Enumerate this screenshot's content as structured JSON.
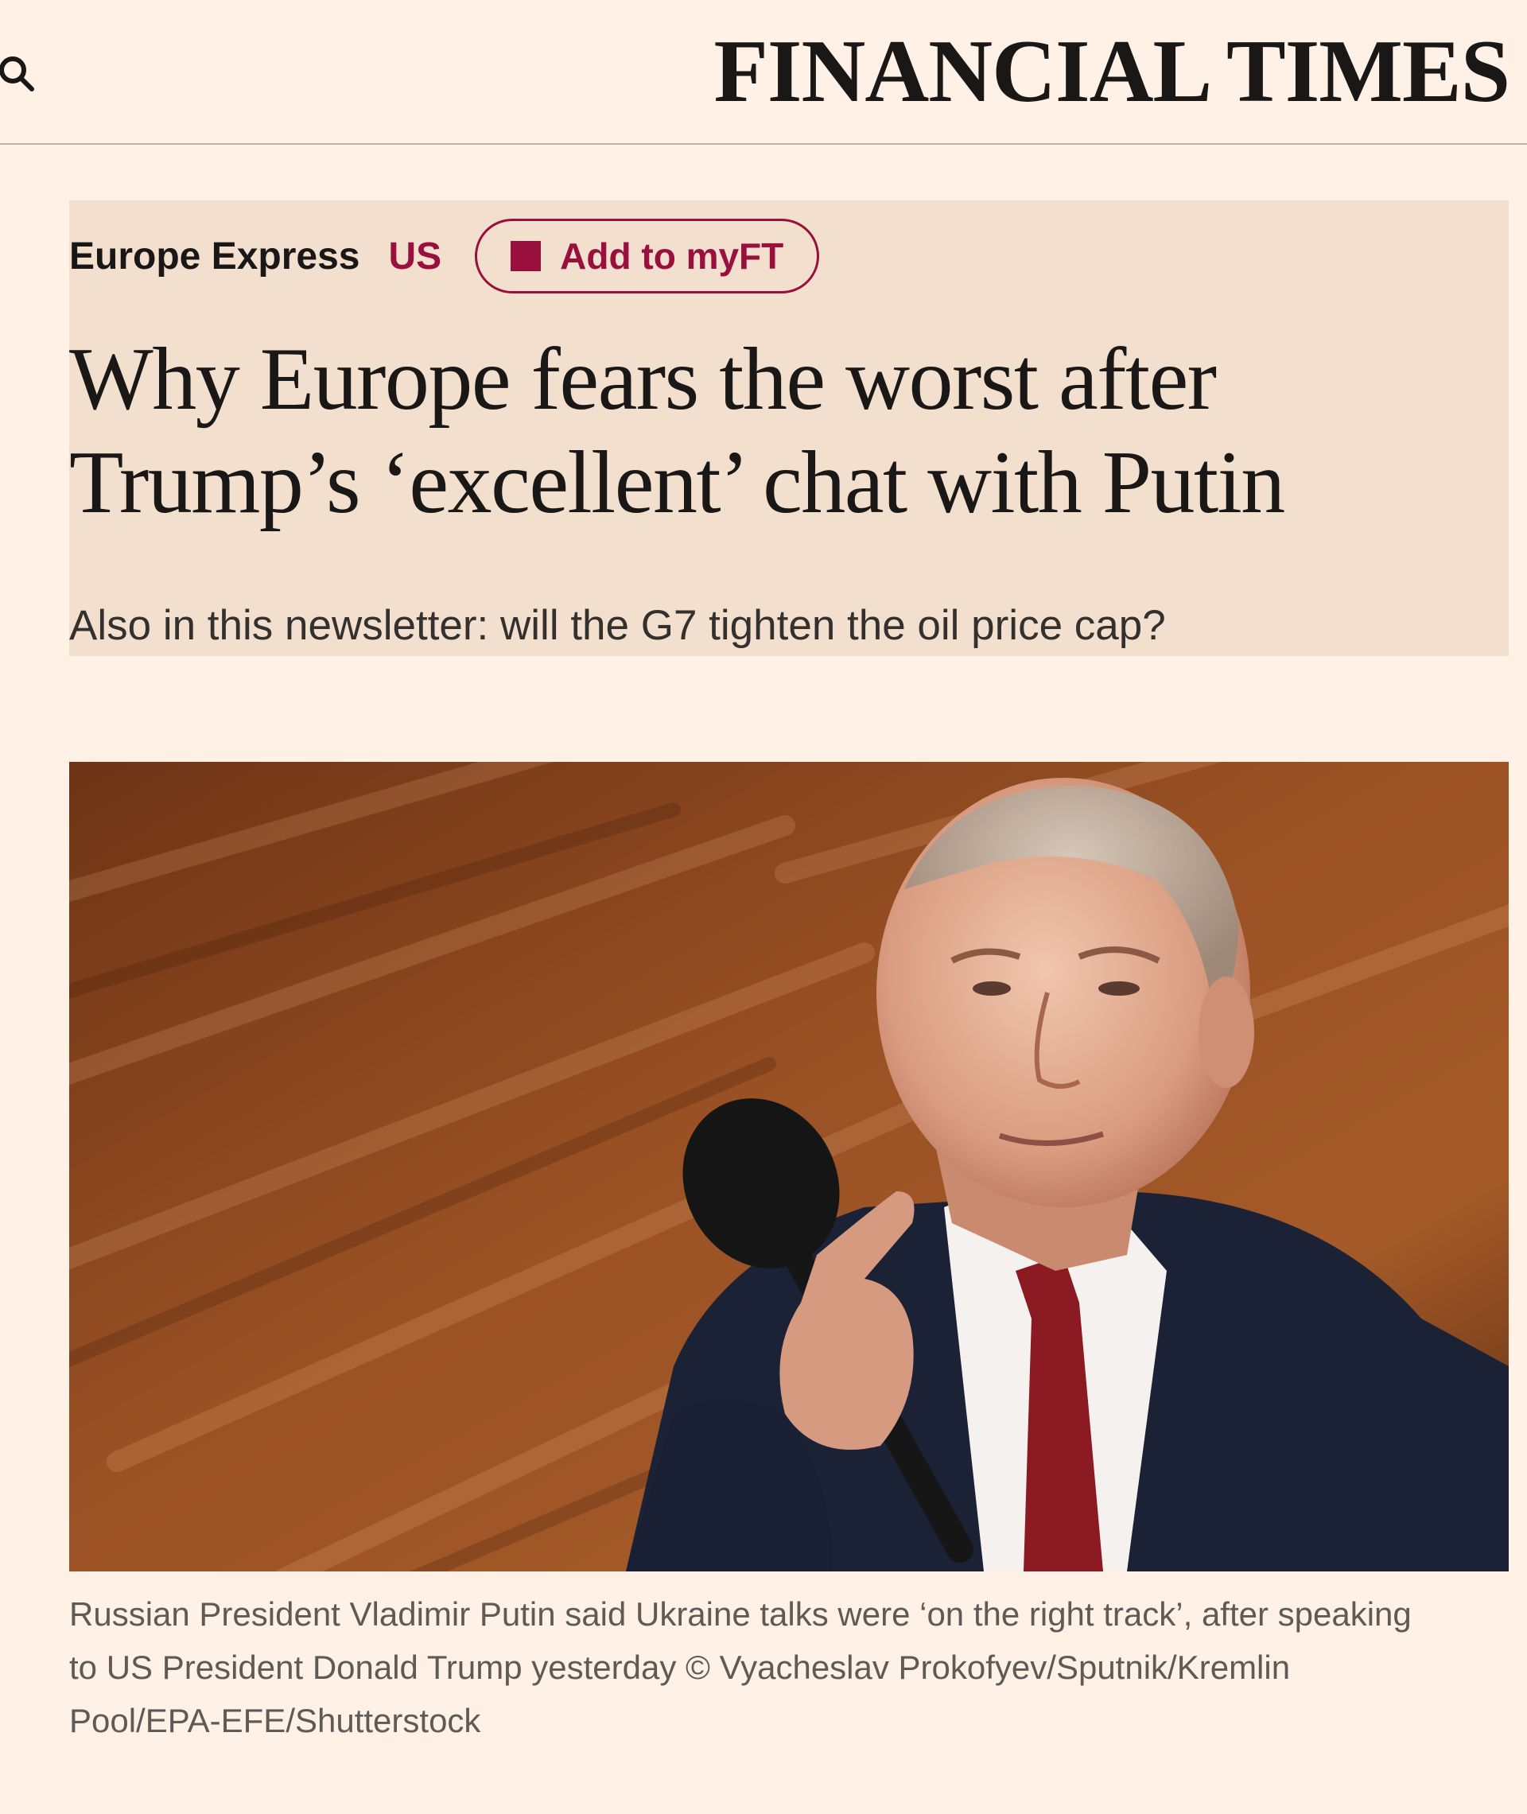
{
  "header": {
    "masthead": "FINANCIAL TIMES",
    "search_icon": "search-icon"
  },
  "article": {
    "topic_primary": "Europe Express",
    "topic_secondary": "US",
    "myft_label": "Add to myFT",
    "headline": "Why Europe fears the worst after Trump’s ‘excellent’ chat with Putin",
    "standfirst": "Also in this newsletter: will the G7 tighten the oil price cap?",
    "caption": "Russian President Vladimir Putin said Ukraine talks were ‘on the right track’, after speaking to US President Donald Trump yesterday © Vyacheslav Prokofyev/Sputnik/Kremlin Pool/EPA-EFE/Shutterstock"
  },
  "colors": {
    "page_background": "#fff1e5",
    "hero_background": "#f2dfce",
    "accent_claret": "#990f3d",
    "text": "#1a1817"
  }
}
